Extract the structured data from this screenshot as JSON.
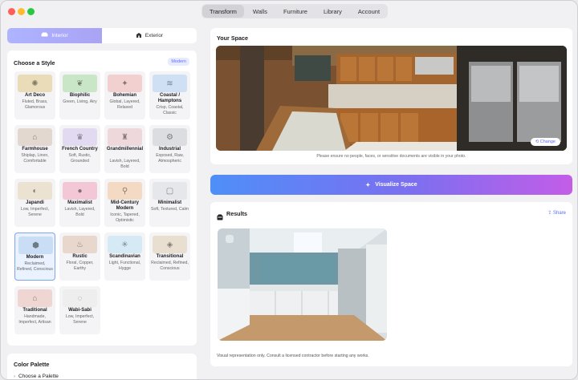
{
  "nav": {
    "tabs": [
      "Transform",
      "Walls",
      "Furniture",
      "Library",
      "Account"
    ]
  },
  "segment": {
    "interior": "Interior",
    "exterior": "Exterior"
  },
  "styles": {
    "title": "Choose a Style",
    "badge": "Modern",
    "items": [
      {
        "name": "Art Deco",
        "desc": "Fluted, Brass, Glamorous",
        "color": "#eadcb9",
        "icon": "sun-icon",
        "glyph": "✺"
      },
      {
        "name": "Biophilic",
        "desc": "Green, Living, Airy",
        "color": "#c9e6c6",
        "icon": "leaf-icon",
        "glyph": "❦"
      },
      {
        "name": "Bohemian",
        "desc": "Global, Layered, Relaxed",
        "color": "#f3d0d0",
        "icon": "sparkles-icon",
        "glyph": "✦"
      },
      {
        "name": "Coastal / Hamptons",
        "desc": "Crisp, Coastal, Classic",
        "color": "#cfe0f5",
        "icon": "waves-icon",
        "glyph": "≋"
      },
      {
        "name": "Farmhouse",
        "desc": "Shiplap, Linen, Comfortable",
        "color": "#e2d8cf",
        "icon": "house-icon",
        "glyph": "⌂"
      },
      {
        "name": "French Country",
        "desc": "Soft, Rustic, Grounded",
        "color": "#e2daf1",
        "icon": "crown-icon",
        "glyph": "♛"
      },
      {
        "name": "Grandmillennial",
        "desc": "Lavish, Layered, Bold",
        "color": "#efd8dc",
        "icon": "chair-icon",
        "glyph": "♜"
      },
      {
        "name": "Industrial",
        "desc": "Exposed, Raw, Atmospheric",
        "color": "#dcdde0",
        "icon": "gear-icon",
        "glyph": "⚙"
      },
      {
        "name": "Japandi",
        "desc": "Low, Imperfect, Serene",
        "color": "#ece2d2",
        "icon": "half-circle-icon",
        "glyph": "◐"
      },
      {
        "name": "Maximalist",
        "desc": "Lavish, Layered, Bold",
        "color": "#f3c7d6",
        "icon": "palette-icon",
        "glyph": "●"
      },
      {
        "name": "Mid-Century Modern",
        "desc": "Iconic, Tapered, Optimistic",
        "color": "#f4dac3",
        "icon": "lamp-icon",
        "glyph": "⚲"
      },
      {
        "name": "Minimalist",
        "desc": "Soft, Textured, Calm",
        "color": "#e6e7ea",
        "icon": "square-icon",
        "glyph": "▢"
      },
      {
        "name": "Modern",
        "desc": "Reclaimed, Refined, Conscious",
        "color": "#c9def4",
        "icon": "cube-icon",
        "glyph": "⬢"
      },
      {
        "name": "Rustic",
        "desc": "Floral, Copper, Earthy",
        "color": "#e7d7cc",
        "icon": "flame-icon",
        "glyph": "♨"
      },
      {
        "name": "Scandinavian",
        "desc": "Light, Functional, Hygge",
        "color": "#d6eaf6",
        "icon": "snowflake-icon",
        "glyph": "✳"
      },
      {
        "name": "Transitional",
        "desc": "Reclaimed, Refined, Conscious",
        "color": "#e8dfd0",
        "icon": "layers-icon",
        "glyph": "◈"
      },
      {
        "name": "Traditional",
        "desc": "Handmade, Imperfect, Artisan",
        "color": "#efd6d2",
        "icon": "columns-icon",
        "glyph": "⌂"
      },
      {
        "name": "Wabi-Sabi",
        "desc": "Low, Imperfect, Serene",
        "color": "#eeeeee",
        "icon": "circle-dashed-icon",
        "glyph": "◌"
      }
    ]
  },
  "palette": {
    "title": "Color Palette",
    "choose": "Choose a Palette"
  },
  "your_space": {
    "title": "Your Space",
    "change": "Change",
    "note": "Please ensure no people, faces, or sensitive documents are visible in your photo."
  },
  "visualize": {
    "label": "Visualize Space"
  },
  "results": {
    "title": "Results",
    "share": "Share",
    "note": "Visual representation only. Consult a licensed contractor before starting any works."
  }
}
